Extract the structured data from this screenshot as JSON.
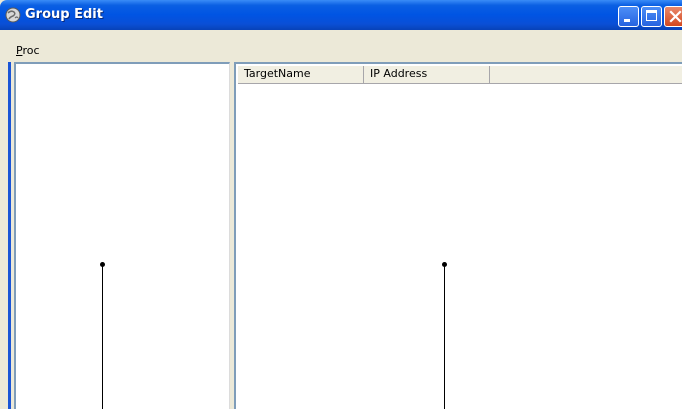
{
  "window": {
    "title": "Group Edit"
  },
  "menubar": {
    "items": [
      {
        "label_accel": "P",
        "label_rest": "roc"
      }
    ]
  },
  "list_view": {
    "columns": [
      "TargetName",
      "IP Address",
      ""
    ]
  },
  "colors": {
    "titlebar": "#0054e3",
    "panel_border": "#7f9db9",
    "window_bg": "#ece9d8",
    "close_button": "#d3481f"
  },
  "icons": [
    "app-globe-icon",
    "minimize-icon",
    "maximize-icon",
    "close-icon"
  ]
}
